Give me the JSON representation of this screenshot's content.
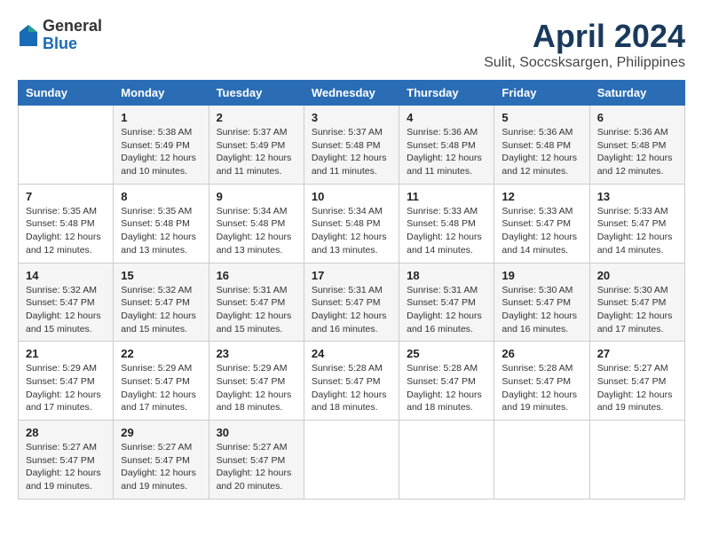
{
  "header": {
    "logo_general": "General",
    "logo_blue": "Blue",
    "title": "April 2024",
    "subtitle": "Sulit, Soccsksargen, Philippines"
  },
  "weekdays": [
    "Sunday",
    "Monday",
    "Tuesday",
    "Wednesday",
    "Thursday",
    "Friday",
    "Saturday"
  ],
  "weeks": [
    [
      {
        "day": "",
        "sunrise": "",
        "sunset": "",
        "daylight": ""
      },
      {
        "day": "1",
        "sunrise": "Sunrise: 5:38 AM",
        "sunset": "Sunset: 5:49 PM",
        "daylight": "Daylight: 12 hours and 10 minutes."
      },
      {
        "day": "2",
        "sunrise": "Sunrise: 5:37 AM",
        "sunset": "Sunset: 5:49 PM",
        "daylight": "Daylight: 12 hours and 11 minutes."
      },
      {
        "day": "3",
        "sunrise": "Sunrise: 5:37 AM",
        "sunset": "Sunset: 5:48 PM",
        "daylight": "Daylight: 12 hours and 11 minutes."
      },
      {
        "day": "4",
        "sunrise": "Sunrise: 5:36 AM",
        "sunset": "Sunset: 5:48 PM",
        "daylight": "Daylight: 12 hours and 11 minutes."
      },
      {
        "day": "5",
        "sunrise": "Sunrise: 5:36 AM",
        "sunset": "Sunset: 5:48 PM",
        "daylight": "Daylight: 12 hours and 12 minutes."
      },
      {
        "day": "6",
        "sunrise": "Sunrise: 5:36 AM",
        "sunset": "Sunset: 5:48 PM",
        "daylight": "Daylight: 12 hours and 12 minutes."
      }
    ],
    [
      {
        "day": "7",
        "sunrise": "Sunrise: 5:35 AM",
        "sunset": "Sunset: 5:48 PM",
        "daylight": "Daylight: 12 hours and 12 minutes."
      },
      {
        "day": "8",
        "sunrise": "Sunrise: 5:35 AM",
        "sunset": "Sunset: 5:48 PM",
        "daylight": "Daylight: 12 hours and 13 minutes."
      },
      {
        "day": "9",
        "sunrise": "Sunrise: 5:34 AM",
        "sunset": "Sunset: 5:48 PM",
        "daylight": "Daylight: 12 hours and 13 minutes."
      },
      {
        "day": "10",
        "sunrise": "Sunrise: 5:34 AM",
        "sunset": "Sunset: 5:48 PM",
        "daylight": "Daylight: 12 hours and 13 minutes."
      },
      {
        "day": "11",
        "sunrise": "Sunrise: 5:33 AM",
        "sunset": "Sunset: 5:48 PM",
        "daylight": "Daylight: 12 hours and 14 minutes."
      },
      {
        "day": "12",
        "sunrise": "Sunrise: 5:33 AM",
        "sunset": "Sunset: 5:47 PM",
        "daylight": "Daylight: 12 hours and 14 minutes."
      },
      {
        "day": "13",
        "sunrise": "Sunrise: 5:33 AM",
        "sunset": "Sunset: 5:47 PM",
        "daylight": "Daylight: 12 hours and 14 minutes."
      }
    ],
    [
      {
        "day": "14",
        "sunrise": "Sunrise: 5:32 AM",
        "sunset": "Sunset: 5:47 PM",
        "daylight": "Daylight: 12 hours and 15 minutes."
      },
      {
        "day": "15",
        "sunrise": "Sunrise: 5:32 AM",
        "sunset": "Sunset: 5:47 PM",
        "daylight": "Daylight: 12 hours and 15 minutes."
      },
      {
        "day": "16",
        "sunrise": "Sunrise: 5:31 AM",
        "sunset": "Sunset: 5:47 PM",
        "daylight": "Daylight: 12 hours and 15 minutes."
      },
      {
        "day": "17",
        "sunrise": "Sunrise: 5:31 AM",
        "sunset": "Sunset: 5:47 PM",
        "daylight": "Daylight: 12 hours and 16 minutes."
      },
      {
        "day": "18",
        "sunrise": "Sunrise: 5:31 AM",
        "sunset": "Sunset: 5:47 PM",
        "daylight": "Daylight: 12 hours and 16 minutes."
      },
      {
        "day": "19",
        "sunrise": "Sunrise: 5:30 AM",
        "sunset": "Sunset: 5:47 PM",
        "daylight": "Daylight: 12 hours and 16 minutes."
      },
      {
        "day": "20",
        "sunrise": "Sunrise: 5:30 AM",
        "sunset": "Sunset: 5:47 PM",
        "daylight": "Daylight: 12 hours and 17 minutes."
      }
    ],
    [
      {
        "day": "21",
        "sunrise": "Sunrise: 5:29 AM",
        "sunset": "Sunset: 5:47 PM",
        "daylight": "Daylight: 12 hours and 17 minutes."
      },
      {
        "day": "22",
        "sunrise": "Sunrise: 5:29 AM",
        "sunset": "Sunset: 5:47 PM",
        "daylight": "Daylight: 12 hours and 17 minutes."
      },
      {
        "day": "23",
        "sunrise": "Sunrise: 5:29 AM",
        "sunset": "Sunset: 5:47 PM",
        "daylight": "Daylight: 12 hours and 18 minutes."
      },
      {
        "day": "24",
        "sunrise": "Sunrise: 5:28 AM",
        "sunset": "Sunset: 5:47 PM",
        "daylight": "Daylight: 12 hours and 18 minutes."
      },
      {
        "day": "25",
        "sunrise": "Sunrise: 5:28 AM",
        "sunset": "Sunset: 5:47 PM",
        "daylight": "Daylight: 12 hours and 18 minutes."
      },
      {
        "day": "26",
        "sunrise": "Sunrise: 5:28 AM",
        "sunset": "Sunset: 5:47 PM",
        "daylight": "Daylight: 12 hours and 19 minutes."
      },
      {
        "day": "27",
        "sunrise": "Sunrise: 5:27 AM",
        "sunset": "Sunset: 5:47 PM",
        "daylight": "Daylight: 12 hours and 19 minutes."
      }
    ],
    [
      {
        "day": "28",
        "sunrise": "Sunrise: 5:27 AM",
        "sunset": "Sunset: 5:47 PM",
        "daylight": "Daylight: 12 hours and 19 minutes."
      },
      {
        "day": "29",
        "sunrise": "Sunrise: 5:27 AM",
        "sunset": "Sunset: 5:47 PM",
        "daylight": "Daylight: 12 hours and 19 minutes."
      },
      {
        "day": "30",
        "sunrise": "Sunrise: 5:27 AM",
        "sunset": "Sunset: 5:47 PM",
        "daylight": "Daylight: 12 hours and 20 minutes."
      },
      {
        "day": "",
        "sunrise": "",
        "sunset": "",
        "daylight": ""
      },
      {
        "day": "",
        "sunrise": "",
        "sunset": "",
        "daylight": ""
      },
      {
        "day": "",
        "sunrise": "",
        "sunset": "",
        "daylight": ""
      },
      {
        "day": "",
        "sunrise": "",
        "sunset": "",
        "daylight": ""
      }
    ]
  ]
}
